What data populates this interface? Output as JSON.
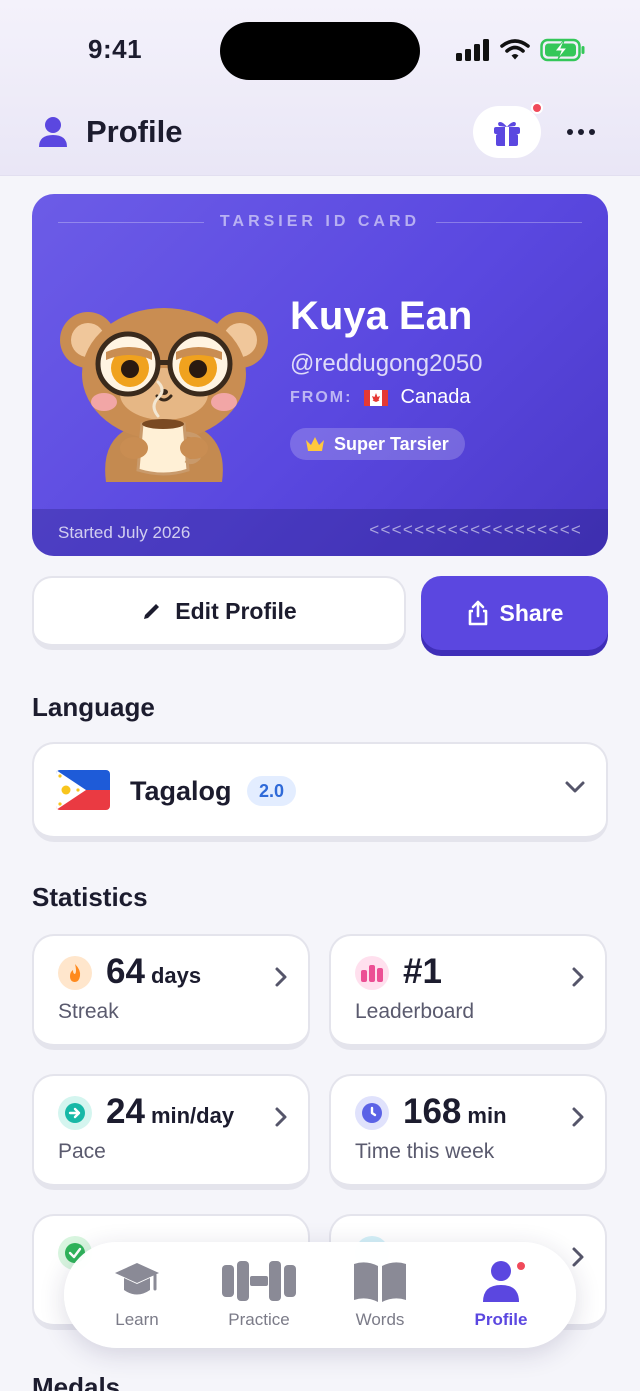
{
  "status_bar": {
    "time": "9:41"
  },
  "header": {
    "title": "Profile"
  },
  "id_card": {
    "card_title": "TARSIER ID CARD",
    "name": "Kuya Ean",
    "handle": "@reddugong2050",
    "from_label": "FROM:",
    "country": "Canada",
    "tier": "Super Tarsier",
    "started": "Started July 2026",
    "mrz": "<<<<<<<<<<<<<<<<<<<"
  },
  "actions": {
    "edit_label": "Edit Profile",
    "share_label": "Share"
  },
  "language_section": {
    "title": "Language",
    "name": "Tagalog",
    "version": "2.0"
  },
  "statistics": {
    "title": "Statistics",
    "items": [
      {
        "value": "64",
        "unit": "days",
        "label": "Streak",
        "icon": "flame-icon",
        "color": "#ff8a1e"
      },
      {
        "value": "#1",
        "unit": "",
        "label": "Leaderboard",
        "icon": "leaderboard-icon",
        "color": "#ec4f94"
      },
      {
        "value": "24",
        "unit": "min/day",
        "label": "Pace",
        "icon": "arrow-right-circle-icon",
        "color": "#17b8a6"
      },
      {
        "value": "168",
        "unit": "min",
        "label": "Time this week",
        "icon": "clock-icon",
        "color": "#5b62e6"
      }
    ]
  },
  "medals": {
    "title": "Medals"
  },
  "tab_bar": {
    "tabs": [
      {
        "label": "Learn",
        "icon": "graduation-cap-icon"
      },
      {
        "label": "Practice",
        "icon": "dumbbell-icon"
      },
      {
        "label": "Words",
        "icon": "book-icon"
      },
      {
        "label": "Profile",
        "icon": "person-icon",
        "active": true
      }
    ]
  },
  "colors": {
    "accent": "#5b47e0",
    "card": "#6c5ce7",
    "notification": "#f04a5a"
  }
}
